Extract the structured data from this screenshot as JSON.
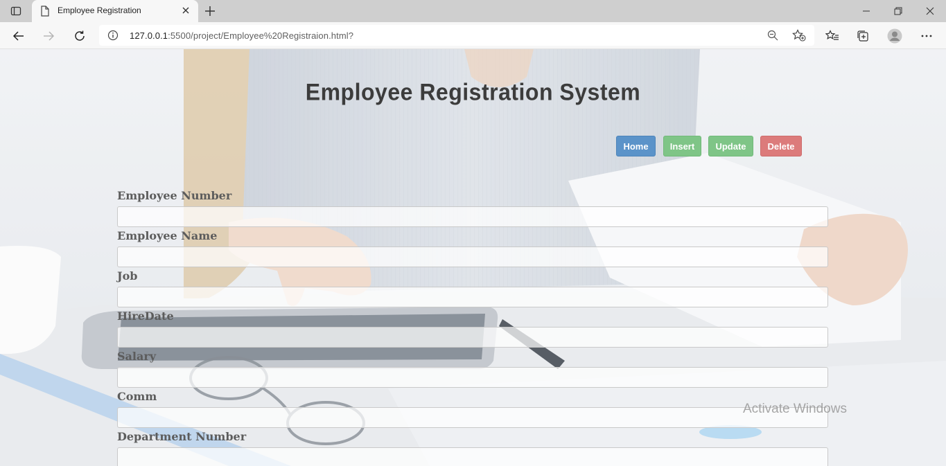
{
  "browser": {
    "tab_title": "Employee Registration",
    "url_host": "127.0.0.1",
    "url_rest": ":5500/project/Employee%20Registraion.html?"
  },
  "page": {
    "title": "Employee Registration System",
    "nav": {
      "home": "Home",
      "insert": "Insert",
      "update": "Update",
      "delete": "Delete"
    },
    "fields": {
      "employee_number": {
        "label": "Employee Number",
        "value": ""
      },
      "employee_name": {
        "label": "Employee Name",
        "value": ""
      },
      "job": {
        "label": "Job",
        "value": ""
      },
      "hire_date": {
        "label": "HireDate",
        "value": ""
      },
      "salary": {
        "label": "Salary",
        "value": ""
      },
      "comm": {
        "label": "Comm",
        "value": ""
      },
      "department_number": {
        "label": "Department Number",
        "value": ""
      }
    }
  },
  "os": {
    "watermark": "Activate Windows"
  },
  "colors": {
    "home_button": "#5b93c9",
    "insert_button": "#7fc587",
    "update_button": "#7fc587",
    "delete_button": "#dc7b7b",
    "title_text": "#3c3c3c"
  }
}
